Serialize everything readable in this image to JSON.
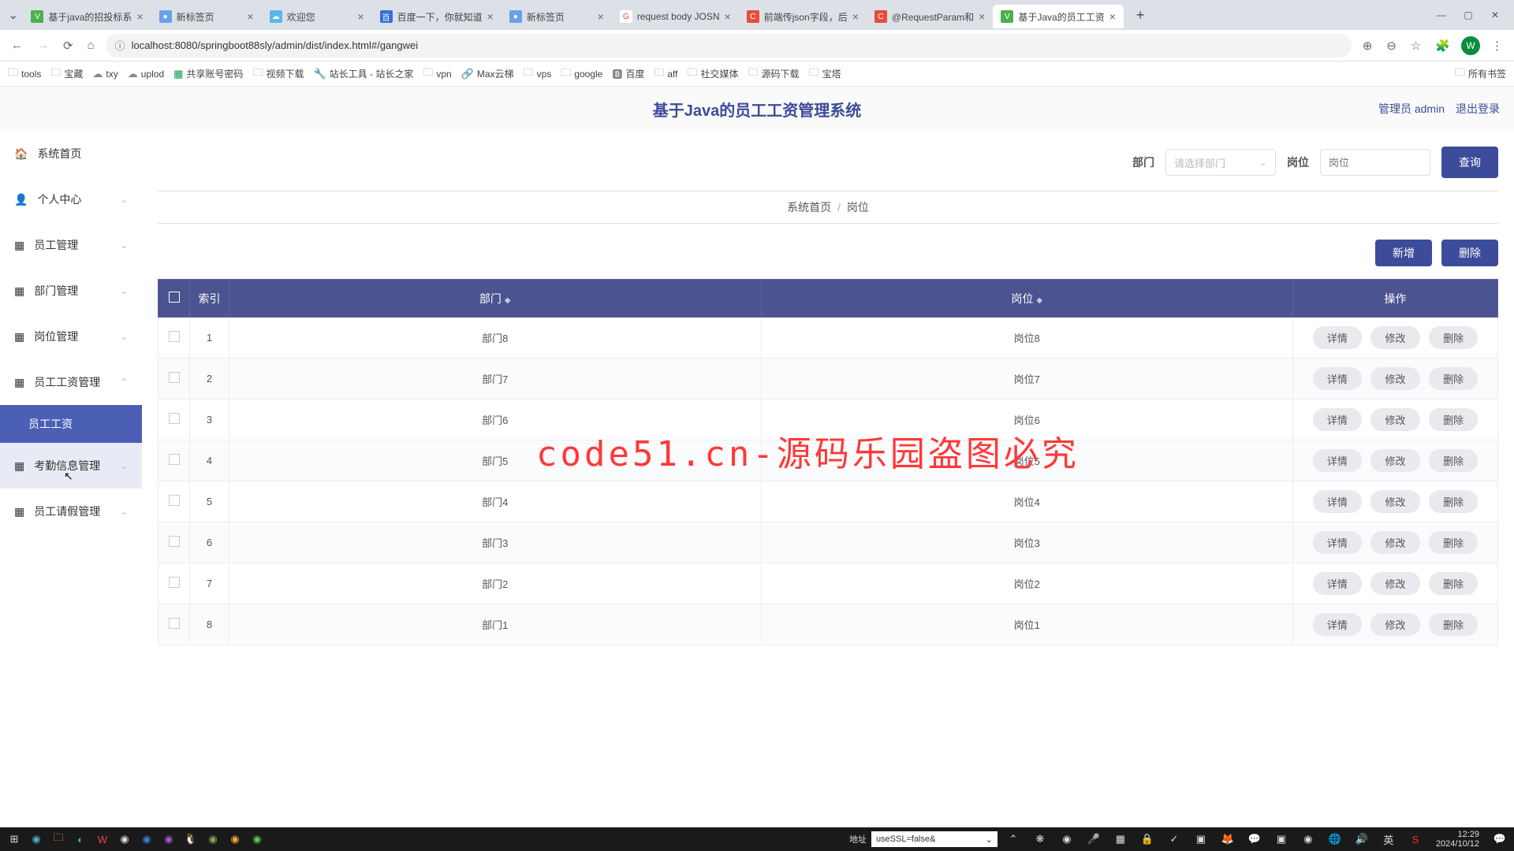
{
  "browser": {
    "tabs": [
      {
        "title": "基于java的招投标系",
        "icon_color": "#4caf50"
      },
      {
        "title": "新标签页",
        "icon_color": "#6aa0e8"
      },
      {
        "title": "欢迎您",
        "icon_color": "#57b8e8"
      },
      {
        "title": "百度一下，你就知道",
        "icon_color": "#3a6fd8"
      },
      {
        "title": "新标签页",
        "icon_color": "#6aa0e8"
      },
      {
        "title": "request body JOSN",
        "icon_color": "#ea4335"
      },
      {
        "title": "前端传json字段，后",
        "icon_color": "#e74c3c"
      },
      {
        "title": "@RequestParam和",
        "icon_color": "#e74c3c"
      },
      {
        "title": "基于Java的员工工资",
        "icon_color": "#4caf50"
      }
    ],
    "url": "localhost:8080/springboot88sly/admin/dist/index.html#/gangwei",
    "avatar_letter": "W",
    "bookmarks": [
      "tools",
      "宝藏",
      "txy",
      "uplod",
      "共享账号密码",
      "视频下载",
      "站长工具 - 站长之家",
      "vpn",
      "Max云梯",
      "vps",
      "google",
      "百度",
      "aff",
      "社交媒体",
      "源码下载",
      "宝塔"
    ],
    "bm_all": "所有书签"
  },
  "header": {
    "title": "基于Java的员工工资管理系统",
    "user_label": "管理员 admin",
    "logout": "退出登录"
  },
  "sidebar": {
    "items": [
      {
        "label": "系统首页",
        "icon": "⌂"
      },
      {
        "label": "个人中心",
        "icon": "👤"
      },
      {
        "label": "员工管理",
        "icon": "▦"
      },
      {
        "label": "部门管理",
        "icon": "▦"
      },
      {
        "label": "岗位管理",
        "icon": "▦"
      },
      {
        "label": "员工工资管理",
        "icon": "▦"
      },
      {
        "label": "考勤信息管理",
        "icon": "▦"
      },
      {
        "label": "员工请假管理",
        "icon": "▦"
      }
    ],
    "submenu": "员工工资"
  },
  "filters": {
    "dept_label": "部门",
    "dept_placeholder": "请选择部门",
    "post_label": "岗位",
    "post_placeholder": "岗位",
    "query_btn": "查询"
  },
  "breadcrumb": {
    "home": "系统首页",
    "current": "岗位"
  },
  "actions": {
    "add": "新增",
    "delete": "删除"
  },
  "table": {
    "headers": {
      "index": "索引",
      "dept": "部门",
      "post": "岗位",
      "ops": "操作"
    },
    "rows": [
      {
        "idx": "1",
        "dept": "部门8",
        "post": "岗位8"
      },
      {
        "idx": "2",
        "dept": "部门7",
        "post": "岗位7"
      },
      {
        "idx": "3",
        "dept": "部门6",
        "post": "岗位6"
      },
      {
        "idx": "4",
        "dept": "部门5",
        "post": "岗位5"
      },
      {
        "idx": "5",
        "dept": "部门4",
        "post": "岗位4"
      },
      {
        "idx": "6",
        "dept": "部门3",
        "post": "岗位3"
      },
      {
        "idx": "7",
        "dept": "部门2",
        "post": "岗位2"
      },
      {
        "idx": "8",
        "dept": "部门1",
        "post": "岗位1"
      }
    ],
    "row_btns": {
      "detail": "详情",
      "edit": "修改",
      "delete": "删除"
    }
  },
  "watermark": "code51.cn-源码乐园盗图必究",
  "taskbar": {
    "addr_label": "地址",
    "addr_value": "useSSL=false&",
    "time": "12:29",
    "date": "2024/10/12"
  }
}
